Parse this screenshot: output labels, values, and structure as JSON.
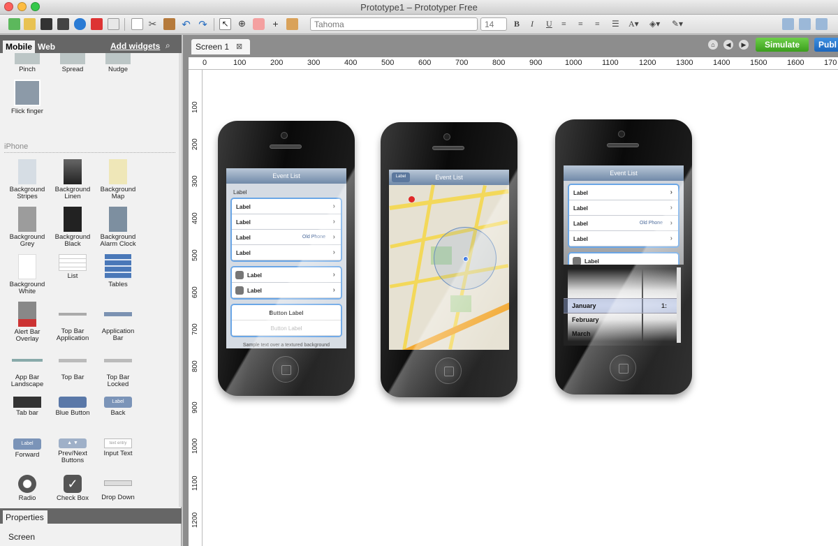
{
  "window": {
    "title": "Prototype1 – Prototyper Free"
  },
  "toolbar": {
    "font": "Tahoma",
    "font_size": "14",
    "bold": "B",
    "italic": "I",
    "underline": "U"
  },
  "sidebar": {
    "tab_mobile": "Mobile",
    "tab_web": "Web",
    "add_widgets": "Add widgets",
    "gestures": [
      "Pinch",
      "Spread",
      "Nudge",
      "Flick finger"
    ],
    "section": "iPhone",
    "widgets": [
      "Background Stripes",
      "Background Linen",
      "Background Map",
      "Background Grey",
      "Background Black",
      "Background Alarm Clock",
      "Background White",
      "List",
      "Tables",
      "Alert Bar Overlay",
      "Top Bar Application",
      "Application Bar",
      "App Bar Landscape",
      "Top Bar",
      "Top Bar Locked",
      "Tab bar",
      "Blue Button",
      "Back",
      "Forward",
      "Prev/Next Buttons",
      "Input Text",
      "Radio",
      "Check Box",
      "Drop Down"
    ],
    "widget_text": {
      "back": "Label",
      "forward": "Label",
      "input": "text entry"
    }
  },
  "properties": {
    "title": "Properties",
    "selected": "Screen"
  },
  "canvas": {
    "tab": "Screen 1",
    "simulate": "Simulate",
    "publish": "Publ",
    "ruler_h": [
      "0",
      "100",
      "200",
      "300",
      "400",
      "500",
      "600",
      "700",
      "800",
      "900",
      "1000",
      "1100",
      "1200",
      "1300",
      "1400",
      "1500",
      "1600",
      "170"
    ],
    "ruler_v": [
      "100",
      "200",
      "300",
      "400",
      "500",
      "600",
      "700",
      "800",
      "900",
      "1000",
      "1100",
      "1200"
    ]
  },
  "phone1": {
    "title": "Event List",
    "group_label": "Label",
    "cells": [
      "Label",
      "Label",
      "Label",
      "Label"
    ],
    "detail": "Old Phone",
    "icon_cells": [
      "Label",
      "Label"
    ],
    "button": "Button Label",
    "button_disabled": "Button Label",
    "footer": "Sample text over a textured background"
  },
  "phone2": {
    "title": "Event List",
    "back": "Label"
  },
  "phone3": {
    "title": "Event List",
    "cells": [
      "Label",
      "Label",
      "Label",
      "Label"
    ],
    "detail": "Old Phone",
    "partial": "Label",
    "months": [
      "January",
      "February",
      "March"
    ],
    "day": "1:"
  },
  "colors": {
    "simulate": "#4cb82d",
    "publish": "#1f6fc7",
    "select": "#6aa6e6"
  }
}
